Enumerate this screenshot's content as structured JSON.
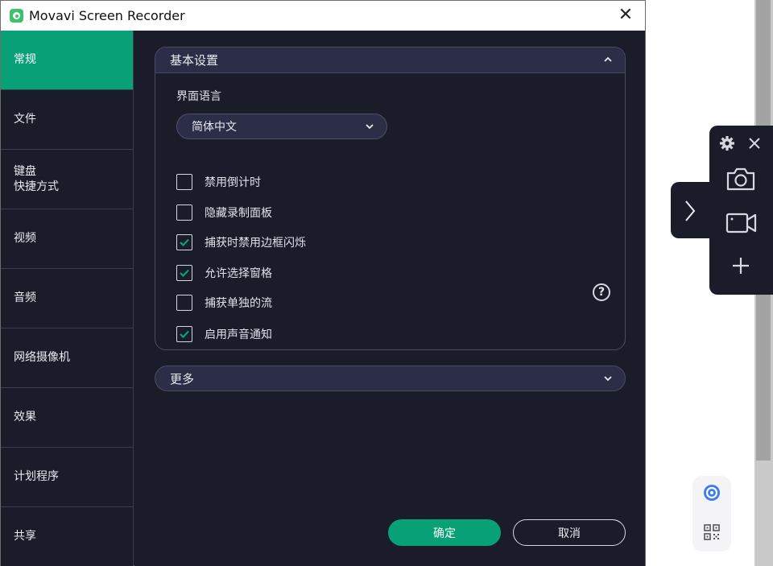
{
  "window": {
    "title": "Movavi Screen Recorder",
    "close_icon": "close-icon"
  },
  "sidebar": {
    "items": [
      {
        "lines": [
          "常规"
        ],
        "active": true
      },
      {
        "lines": [
          "文件"
        ],
        "active": false
      },
      {
        "lines": [
          "键盘",
          "快捷方式"
        ],
        "active": false
      },
      {
        "lines": [
          "视频"
        ],
        "active": false
      },
      {
        "lines": [
          "音频"
        ],
        "active": false
      },
      {
        "lines": [
          "网络摄像机"
        ],
        "active": false
      },
      {
        "lines": [
          "效果"
        ],
        "active": false
      },
      {
        "lines": [
          "计划程序"
        ],
        "active": false
      },
      {
        "lines": [
          "共享"
        ],
        "active": false
      }
    ]
  },
  "basic_settings": {
    "header": "基本设置",
    "language_label": "界面语言",
    "language_value": "简体中文",
    "options": [
      {
        "label": "禁用倒计时",
        "checked": false
      },
      {
        "label": "隐藏录制面板",
        "checked": false
      },
      {
        "label": "捕获时禁用边框闪烁",
        "checked": true
      },
      {
        "label": "允许选择窗格",
        "checked": true
      },
      {
        "label": "捕获单独的流",
        "checked": false
      },
      {
        "label": "启用声音通知",
        "checked": true
      }
    ],
    "help_glyph": "?"
  },
  "more": {
    "label": "更多"
  },
  "buttons": {
    "ok": "确定",
    "cancel": "取消"
  },
  "float_panel": {
    "icons": [
      "gear-icon",
      "close-icon",
      "camera-icon",
      "video-camera-icon",
      "plus-icon"
    ],
    "expand_icon": "chevron-right-icon"
  },
  "mini_bar": {
    "icons": [
      "browser-icon",
      "qr-code-icon"
    ]
  },
  "colors": {
    "accent": "#07a077",
    "background": "#1b1c2a",
    "panel_header": "#2c2d47",
    "border": "#4a4b63"
  }
}
